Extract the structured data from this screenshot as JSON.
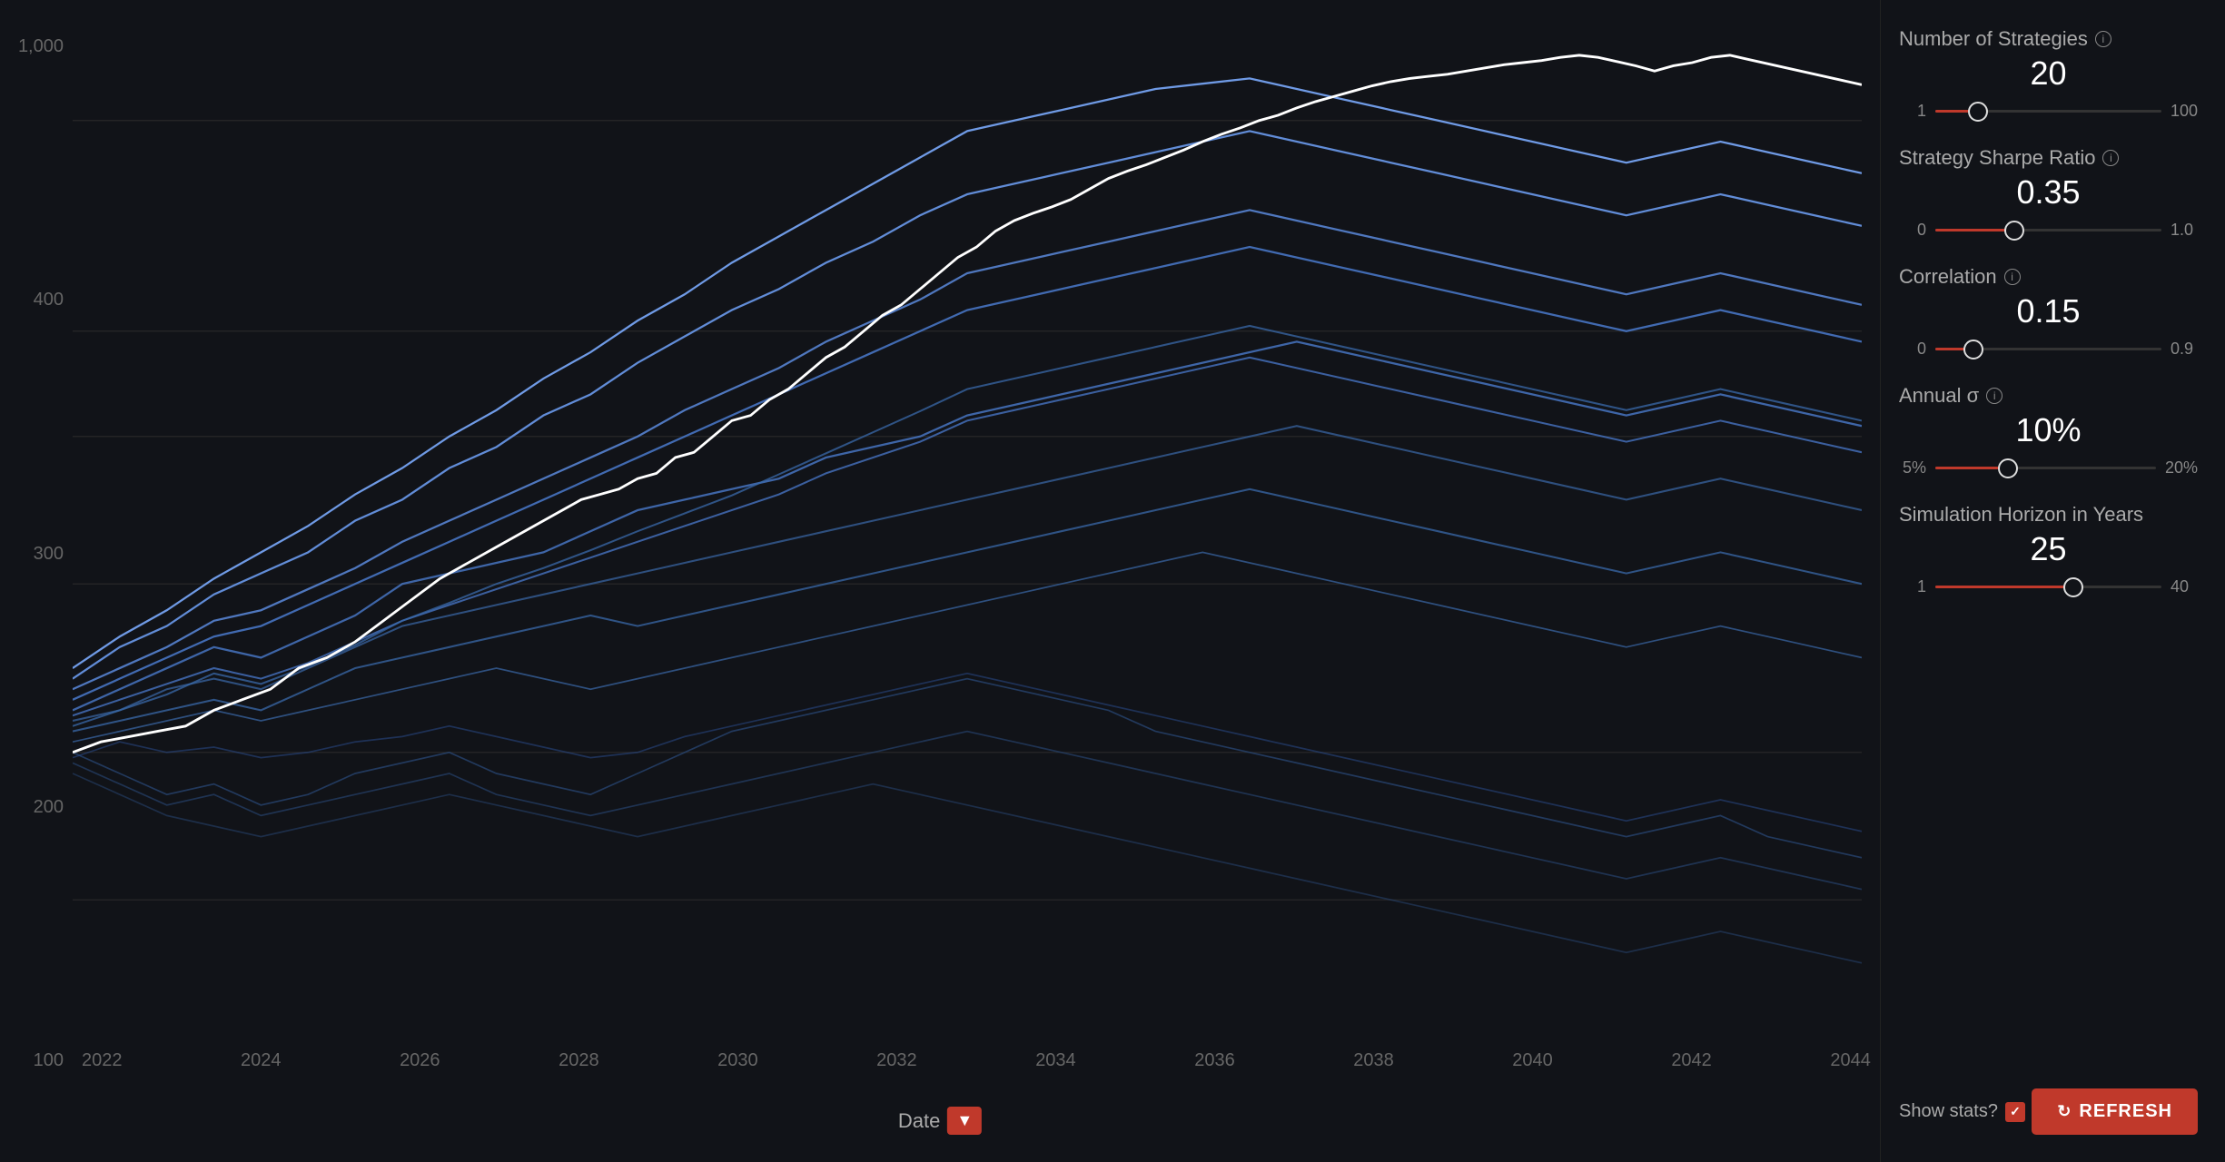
{
  "sidebar": {
    "controls": [
      {
        "id": "num-strategies",
        "label": "Number of Strategies",
        "value": "20",
        "min": "1",
        "max": "100",
        "fill_pct": 19,
        "thumb_pct": 19
      },
      {
        "id": "sharpe-ratio",
        "label": "Strategy Sharpe Ratio",
        "value": "0.35",
        "min": "0",
        "max": "1.0",
        "fill_pct": 35,
        "thumb_pct": 35
      },
      {
        "id": "correlation",
        "label": "Correlation",
        "value": "0.15",
        "min": "0",
        "max": "0.9",
        "fill_pct": 17,
        "thumb_pct": 17
      },
      {
        "id": "annual-sigma",
        "label": "Annual σ",
        "value": "10%",
        "min": "5%",
        "max": "20%",
        "fill_pct": 33,
        "thumb_pct": 33
      },
      {
        "id": "sim-horizon",
        "label": "Simulation Horizon in Years",
        "value": "25",
        "min": "1",
        "max": "40",
        "fill_pct": 61,
        "thumb_pct": 61
      }
    ],
    "show_stats_label": "Show stats?",
    "show_stats_checked": true,
    "refresh_label": "REFRESH"
  },
  "chart": {
    "y_labels": [
      "1,000",
      "400",
      "300",
      "200",
      "100"
    ],
    "x_labels": [
      "2022",
      "2024",
      "2026",
      "2028",
      "2030",
      "2032",
      "2034",
      "2036",
      "2038",
      "2040",
      "2042",
      "2044"
    ],
    "x_axis_label": "Date"
  }
}
